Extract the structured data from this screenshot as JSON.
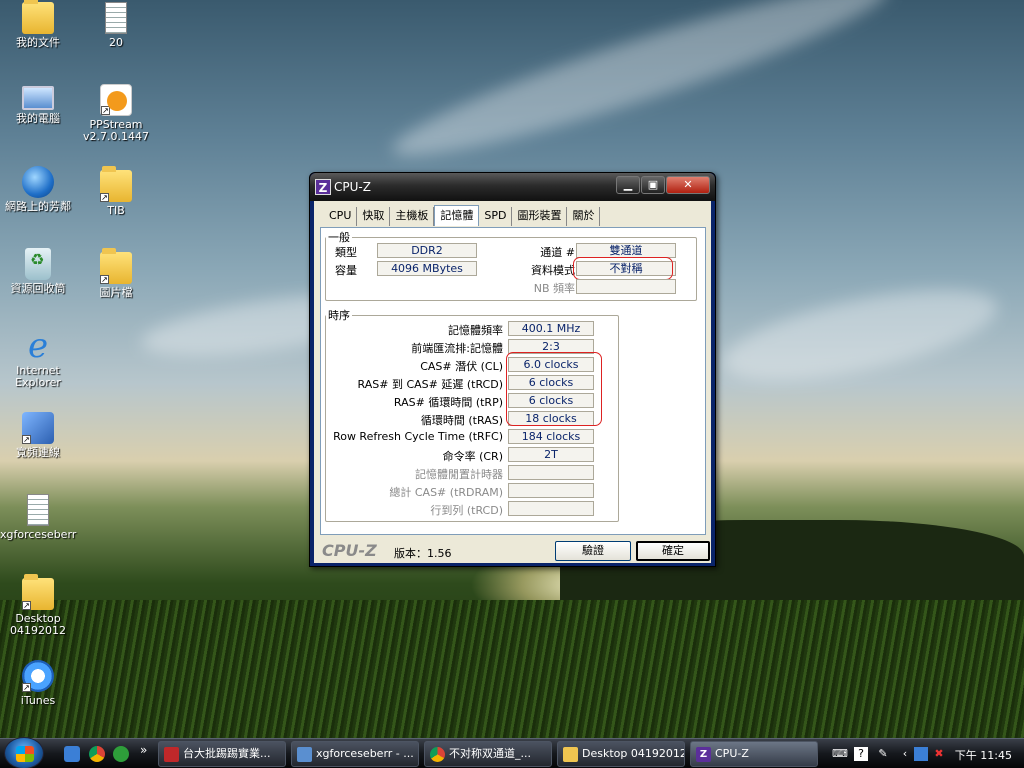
{
  "desktop": {
    "icons": [
      {
        "label": "我的文件",
        "icon": "documents-folder-icon"
      },
      {
        "label": "20",
        "icon": "text-file-icon"
      },
      {
        "label": "我的電腦",
        "icon": "computer-icon"
      },
      {
        "label": "PPStream v2.7.0.1447",
        "icon": "ppstream-icon"
      },
      {
        "label": "網路上的芳鄰",
        "icon": "network-icon"
      },
      {
        "label": "TIB",
        "icon": "folder-icon"
      },
      {
        "label": "資源回收筒",
        "icon": "recycle-bin-icon"
      },
      {
        "label": "圖片檔",
        "icon": "folder-icon"
      },
      {
        "label": "Internet Explorer",
        "icon": "internet-explorer-icon"
      },
      {
        "label": "寬頻連線",
        "icon": "broadband-connection-icon"
      },
      {
        "label": "xgforceseberr",
        "icon": "text-file-icon"
      },
      {
        "label": "Desktop 04192012",
        "icon": "folder-icon"
      },
      {
        "label": "iTunes",
        "icon": "itunes-icon"
      }
    ]
  },
  "window": {
    "title": "CPU-Z",
    "tabs": [
      "CPU",
      "快取",
      "主機板",
      "記憶體",
      "SPD",
      "圖形裝置",
      "關於"
    ],
    "active_tab": "記憶體",
    "general": {
      "legend": "一般",
      "type_label": "類型",
      "type_value": "DDR2",
      "size_label": "容量",
      "size_value": "4096 MBytes",
      "channel_label": "通道 #",
      "channel_value": "雙通道",
      "dc_mode_label": "資料模式",
      "dc_mode_value": "不對稱",
      "nb_freq_label": "NB 頻率",
      "nb_freq_value": ""
    },
    "timings": {
      "legend": "時序",
      "rows": [
        {
          "label": "記憶體頻率",
          "value": "400.1 MHz",
          "enabled": true
        },
        {
          "label": "前端匯流排:記憶體",
          "value": "2:3",
          "enabled": true
        },
        {
          "label": "CAS# 潛伏 (CL)",
          "value": "6.0 clocks",
          "enabled": true
        },
        {
          "label": "RAS# 到 CAS# 延遲 (tRCD)",
          "value": "6 clocks",
          "enabled": true
        },
        {
          "label": "RAS# 循環時間 (tRP)",
          "value": "6 clocks",
          "enabled": true
        },
        {
          "label": "循環時間 (tRAS)",
          "value": "18 clocks",
          "enabled": true
        },
        {
          "label": "Row Refresh Cycle Time (tRFC)",
          "value": "184 clocks",
          "enabled": true
        },
        {
          "label": "命令率 (CR)",
          "value": "2T",
          "enabled": true
        },
        {
          "label": "記憶體閒置計時器",
          "value": "",
          "enabled": false
        },
        {
          "label": "總計 CAS# (tRDRAM)",
          "value": "",
          "enabled": false
        },
        {
          "label": "行到列 (tRCD)",
          "value": "",
          "enabled": false
        }
      ]
    },
    "footer": {
      "brand": "CPU-Z",
      "version_label": "版本：",
      "version_value": "1.56",
      "validate_button": "驗證",
      "ok_button": "確定"
    }
  },
  "taskbar": {
    "tasks": [
      {
        "label": "台大批踢踢實業...",
        "active": false
      },
      {
        "label": "xgforceseberr - ...",
        "active": false
      },
      {
        "label": "不对称双通道_...",
        "active": false
      },
      {
        "label": "Desktop 04192012",
        "active": false
      },
      {
        "label": "CPU-Z",
        "active": true
      }
    ],
    "clock": "下午 11:45"
  },
  "colors": {
    "title_bar": "#2b2b2b",
    "window_face": "#ece9d8",
    "value_text": "#0a246a",
    "highlight_ring": "#dd2222"
  }
}
